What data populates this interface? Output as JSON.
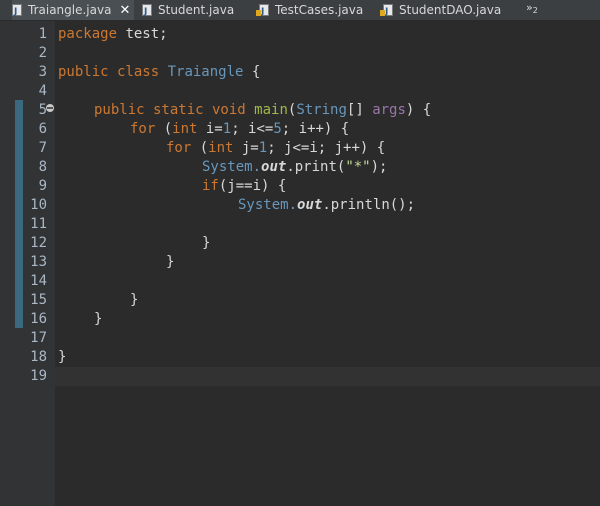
{
  "tabs": [
    {
      "label": "Traiangle.java",
      "active": true,
      "closable": true,
      "icon": "java-file-icon"
    },
    {
      "label": "Student.java",
      "active": false,
      "icon": "java-file-icon"
    },
    {
      "label": "TestCases.java",
      "active": false,
      "icon": "java-test-file-icon"
    },
    {
      "label": "StudentDAO.java",
      "active": false,
      "icon": "java-test-file-icon"
    }
  ],
  "overflow": {
    "symbol": "»",
    "count": "2"
  },
  "close_symbol": "✕",
  "line_numbers": [
    "1",
    "2",
    "3",
    "4",
    "5",
    "6",
    "7",
    "8",
    "9",
    "10",
    "11",
    "12",
    "13",
    "14",
    "15",
    "16",
    "17",
    "18",
    "19"
  ],
  "code": {
    "l1": {
      "kw": "package",
      "rest": " test;"
    },
    "l3": {
      "kw": "public class",
      "name": "Traiangle",
      "rest": " {"
    },
    "l5": {
      "mods": "public static void",
      "fn": "main",
      "open": "(",
      "type": "String",
      "arr": "[] ",
      "arg": "args",
      "close": ") {"
    },
    "l6": {
      "kw": "for",
      "p1": " (",
      "ty": "int",
      "p2": " i=",
      "n1": "1",
      "p3": "; i<=",
      "n2": "5",
      "p4": "; i++) {"
    },
    "l7": {
      "kw": "for",
      "p1": " (",
      "ty": "int",
      "p2": " j=",
      "n1": "1",
      "p3": "; j<=i; j++) {"
    },
    "l8": {
      "sys": "System.",
      "fld": "out",
      "call": ".print(",
      "str": "\"*\"",
      "end": ");"
    },
    "l9": {
      "kw": "if",
      "rest": "(j==i) {"
    },
    "l10": {
      "sys": "System.",
      "fld": "out",
      "call": ".println();"
    },
    "l12": {
      "text": "}"
    },
    "l13": {
      "text": "}"
    },
    "l15": {
      "text": "}"
    },
    "l16": {
      "text": "}"
    },
    "l18": {
      "text": "}"
    }
  }
}
